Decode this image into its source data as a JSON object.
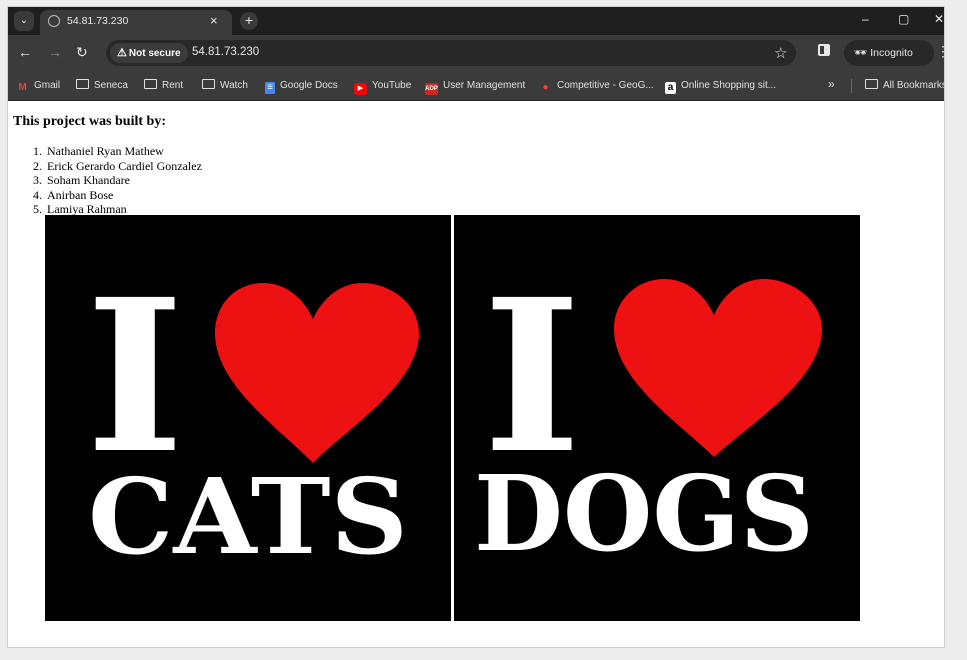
{
  "browser": {
    "tab_title": "54.81.73.230",
    "tab_close": "×",
    "new_tab": "+",
    "security_label": "Not secure",
    "url": "54.81.73.230",
    "incognito_label": "Incognito",
    "window_controls": {
      "minimize": "–",
      "maximize": "▢",
      "close": "✕"
    }
  },
  "bookmarks": [
    {
      "label": "Gmail",
      "icon": "gmail-icon"
    },
    {
      "label": "Seneca",
      "icon": "folder-icon"
    },
    {
      "label": "Rent",
      "icon": "folder-icon"
    },
    {
      "label": "Watch",
      "icon": "folder-icon"
    },
    {
      "label": "Google Docs",
      "icon": "docs-icon"
    },
    {
      "label": "YouTube",
      "icon": "youtube-icon"
    },
    {
      "label": "User Management",
      "icon": "adp-icon"
    },
    {
      "label": "Competitive - GeoG...",
      "icon": "location-pin-icon"
    },
    {
      "label": "Online Shopping sit...",
      "icon": "amazon-icon"
    }
  ],
  "bookmarks_overflow": "»",
  "all_bookmarks": "All Bookmarks",
  "page": {
    "heading": "This project was built by:",
    "builders": [
      "Nathaniel Ryan Mathew",
      "Erick Gerardo Cardiel Gonzalez",
      "Soham Khandare",
      "Anirban Bose",
      "Lamiya Rahman"
    ],
    "images": [
      {
        "top": "I",
        "bottom": "CATS",
        "heart_color": "#ee1111"
      },
      {
        "top": "I",
        "bottom": "DOGS",
        "heart_color": "#ee1111"
      }
    ]
  }
}
